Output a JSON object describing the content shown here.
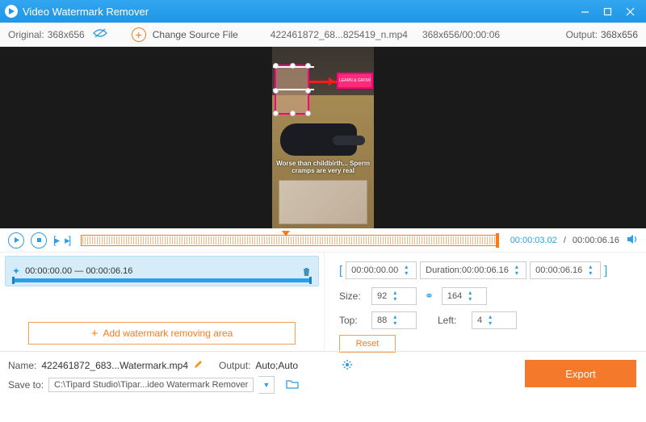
{
  "titlebar": {
    "title": "Video Watermark Remover"
  },
  "toolbar": {
    "original_label": "Original:",
    "original_value": "368x656",
    "change_source": "Change Source File",
    "filename": "422461872_68...825419_n.mp4",
    "dims_time": "368x656/00:00:06",
    "output_label": "Output:",
    "output_value": "368x656"
  },
  "preview": {
    "caption": "Worse than childbirth... Sperm cramps are very real",
    "badge": "LEARN & GROW"
  },
  "transport": {
    "current": "00:00:03.02",
    "total": "00:00:06.16"
  },
  "segment": {
    "start": "00:00:00.00",
    "sep": "—",
    "end": "00:00:06.16"
  },
  "add_area": "Add watermark removing area",
  "params": {
    "start": "00:00:00.00",
    "duration_label": "Duration:",
    "duration": "00:00:06.16",
    "end": "00:00:06.16",
    "size_label": "Size:",
    "size_w": "92",
    "size_h": "164",
    "top_label": "Top:",
    "top": "88",
    "left_label": "Left:",
    "left": "4",
    "reset": "Reset"
  },
  "footer": {
    "name_label": "Name:",
    "name_value": "422461872_683...Watermark.mp4",
    "output_label": "Output:",
    "output_value": "Auto;Auto",
    "save_label": "Save to:",
    "save_path": "C:\\Tipard Studio\\Tipar...ideo Watermark Remover",
    "export": "Export"
  }
}
